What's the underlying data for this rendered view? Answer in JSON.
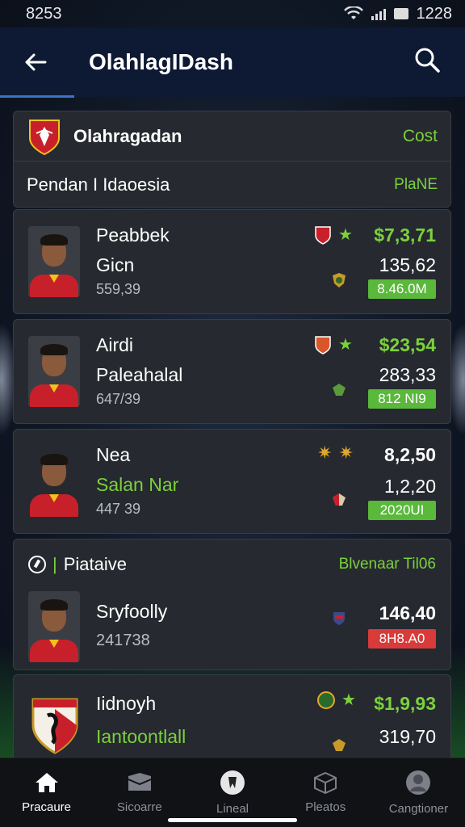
{
  "status_bar": {
    "time_left": "8253",
    "time_right": "1228"
  },
  "header": {
    "title": "OlahlagIDash"
  },
  "league": {
    "name": "Olahragadan",
    "cost": "Cost",
    "subtitle": "Pendan I Idaoesia",
    "tag": "PlaNE"
  },
  "players": [
    {
      "name": "Peabbek",
      "club": "Gicn",
      "number": "559,39",
      "value": "$7,3,71",
      "secondary": "135,62",
      "badge": "8.46.0M",
      "badge_color": "#5ab83a"
    },
    {
      "name": "Airdi",
      "club": "Paleahalal",
      "number": "647/39",
      "value": "$23,54",
      "secondary": "283,33",
      "badge": "812 NI9",
      "badge_color": "#5ab83a"
    },
    {
      "name": "Nea",
      "club": "Salan Nar",
      "number": "447 39",
      "value": "8,2,50",
      "secondary": "1,2,20",
      "badge": "2020UI",
      "badge_color": "#5ab83a"
    }
  ],
  "section": {
    "label": "Piataive",
    "extra": "Blvenaar Til06",
    "player": {
      "name": "Sryfoolly",
      "number": "241738",
      "value": "146,40",
      "badge": "8H8.A0",
      "badge_color": "#d93a3a"
    }
  },
  "last_card": {
    "name": "Iidnoyh",
    "club": "Iantoontlall",
    "value": "$1,9,93",
    "secondary": "319,70"
  },
  "nav": [
    {
      "label": "Pracaure",
      "icon": "home-icon",
      "active": true
    },
    {
      "label": "Sicoarre",
      "icon": "folder-icon",
      "active": false
    },
    {
      "label": "Lineal",
      "icon": "ball-icon",
      "active": false
    },
    {
      "label": "Pleatos",
      "icon": "box-icon",
      "active": false
    },
    {
      "label": "Cangtioner",
      "icon": "profile-icon",
      "active": false
    }
  ],
  "colors": {
    "accent_green": "#7bd13c",
    "header_bg": "#0e1a33",
    "card_bg": "#26292f"
  }
}
